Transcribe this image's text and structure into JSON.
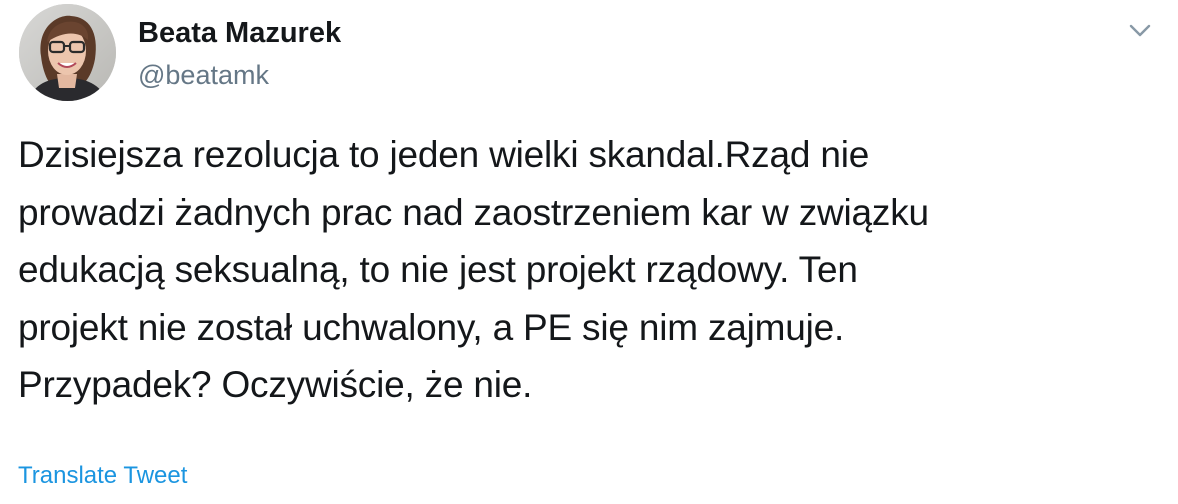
{
  "author": {
    "display_name": "Beata Mazurek",
    "handle": "@beatamk"
  },
  "icons": {
    "avatar": "profile-photo",
    "menu": "chevron-down-icon"
  },
  "tweet": {
    "lines": [
      "Dzisiejsza rezolucja to jeden wielki skandal.Rząd nie",
      "prowadzi żadnych prac nad zaostrzeniem kar w związku",
      "edukacją seksualną, to nie jest projekt rządowy. Ten",
      "projekt nie został uchwalony, a PE się nim zajmuje.",
      "Przypadek? Oczywiście, że nie."
    ],
    "translate_label": "Translate Tweet"
  },
  "colors": {
    "text": "#14171a",
    "secondary": "#657786",
    "link": "#1b95e0",
    "chevron": "#8899a6"
  }
}
